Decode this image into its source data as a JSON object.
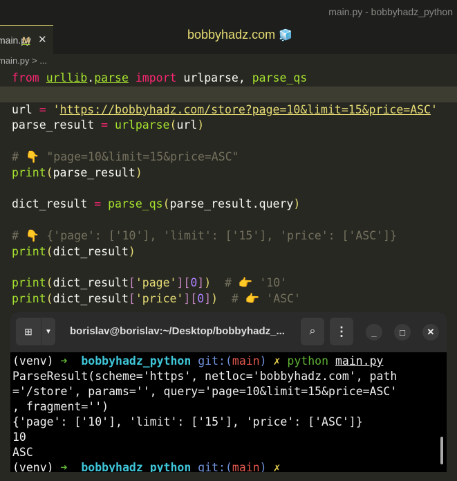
{
  "window_title": "main.py - bobbyhadz_python",
  "tab": {
    "name": "main.py",
    "modified": "M",
    "close": "✕"
  },
  "brand": {
    "text": "bobbyhadz.com",
    "icon": "cube-icon"
  },
  "breadcrumb": "main.py > ...",
  "code": [
    [
      [
        "from",
        "kw"
      ],
      [
        " ",
        "id"
      ],
      [
        "urllib",
        "mod"
      ],
      [
        ".",
        "id"
      ],
      [
        "parse",
        "mod"
      ],
      [
        " ",
        "id"
      ],
      [
        "import",
        "kw"
      ],
      [
        " urlparse, ",
        "id"
      ],
      [
        "parse_qs",
        "fn"
      ]
    ],
    [],
    [
      [
        "url ",
        "id"
      ],
      [
        "=",
        "op"
      ],
      [
        " '",
        "str"
      ],
      [
        "https://bobbyhadz.com/store?page=10&limit=15&price=ASC",
        "url"
      ],
      [
        "'",
        "str"
      ]
    ],
    [
      [
        "parse_result ",
        "id"
      ],
      [
        "=",
        "op"
      ],
      [
        " ",
        "id"
      ],
      [
        "urlparse",
        "fn"
      ],
      [
        "(",
        "par"
      ],
      [
        "url",
        "id"
      ],
      [
        ")",
        "par"
      ]
    ],
    [],
    [
      [
        "# 👇 \"page=10&limit=15&price=ASC\"",
        "cm"
      ]
    ],
    [
      [
        "print",
        "fn"
      ],
      [
        "(",
        "par"
      ],
      [
        "parse_result",
        "id"
      ],
      [
        ")",
        "par"
      ]
    ],
    [],
    [
      [
        "dict_result ",
        "id"
      ],
      [
        "=",
        "op"
      ],
      [
        " ",
        "id"
      ],
      [
        "parse_qs",
        "fn"
      ],
      [
        "(",
        "par"
      ],
      [
        "parse_result.query",
        "id"
      ],
      [
        ")",
        "par"
      ]
    ],
    [],
    [
      [
        "# 👇 {'page': ['10'], 'limit': ['15'], 'price': ['ASC']}",
        "cm"
      ]
    ],
    [
      [
        "print",
        "fn"
      ],
      [
        "(",
        "par"
      ],
      [
        "dict_result",
        "id"
      ],
      [
        ")",
        "par"
      ]
    ],
    [],
    [
      [
        "print",
        "fn"
      ],
      [
        "(",
        "par"
      ],
      [
        "dict_result",
        "id"
      ],
      [
        "[",
        "brk"
      ],
      [
        "'page'",
        "str"
      ],
      [
        "][",
        "brk"
      ],
      [
        "0",
        "num"
      ],
      [
        "]",
        "brk"
      ],
      [
        ")",
        "par"
      ],
      [
        "  # 👉 '10'",
        "cm"
      ]
    ],
    [
      [
        "print",
        "fn"
      ],
      [
        "(",
        "par"
      ],
      [
        "dict_result",
        "id"
      ],
      [
        "[",
        "brk"
      ],
      [
        "'price'",
        "str"
      ],
      [
        "][",
        "brk"
      ],
      [
        "0",
        "num"
      ],
      [
        "]",
        "brk"
      ],
      [
        ")",
        "par"
      ],
      [
        "  # 👉 'ASC'",
        "cm"
      ]
    ]
  ],
  "terminal": {
    "title": "borislav@borislav:~/Desktop/bobbyhadz_...",
    "lines": [
      [
        [
          "(venv) ",
          ""
        ],
        [
          "➜ ",
          "g"
        ],
        [
          " bobbyhadz_python ",
          "c"
        ],
        [
          "git:(",
          "b"
        ],
        [
          "main",
          "r"
        ],
        [
          ") ",
          "b"
        ],
        [
          "✗ ",
          "y"
        ],
        [
          "python ",
          "g"
        ],
        [
          "main.py",
          "u"
        ]
      ],
      [
        [
          "ParseResult(scheme='https', netloc='bobbyhadz.com', path",
          ""
        ]
      ],
      [
        [
          "='/store', params='', query='page=10&limit=15&price=ASC'",
          ""
        ]
      ],
      [
        [
          ", fragment='')",
          ""
        ]
      ],
      [
        [
          "{'page': ['10'], 'limit': ['15'], 'price': ['ASC']}",
          ""
        ]
      ],
      [
        [
          "10",
          ""
        ]
      ],
      [
        [
          "ASC",
          ""
        ]
      ],
      [
        [
          "(venv) ",
          ""
        ],
        [
          "➜ ",
          "g"
        ],
        [
          " bobbyhadz_python ",
          "c"
        ],
        [
          "git:(",
          "b"
        ],
        [
          "main",
          "r"
        ],
        [
          ") ",
          "b"
        ],
        [
          "✗",
          "y"
        ]
      ]
    ]
  }
}
